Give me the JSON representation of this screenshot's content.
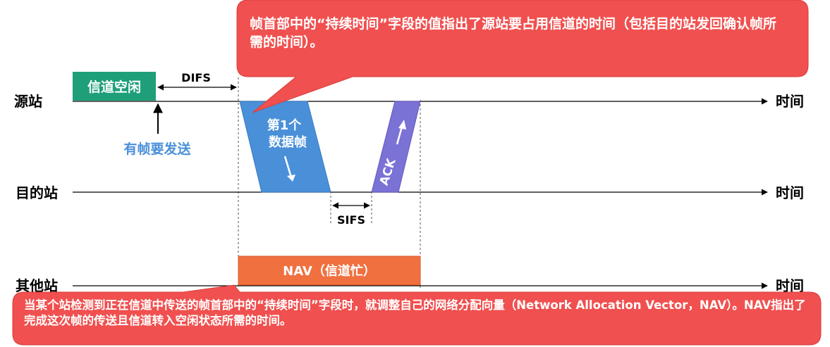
{
  "stations": {
    "source": "源站",
    "dest": "目的站",
    "other": "其他站"
  },
  "time_label": "时间",
  "channel_idle": "信道空闲",
  "difs": "DIFS",
  "sifs": "SIFS",
  "has_frame": "有帧要发送",
  "data_frame": [
    "第1个",
    "数据帧"
  ],
  "ack": "ACK",
  "nav_bar": "NAV（信道忙）",
  "top_callout": "帧首部中的“持续时间”字段的值指出了源站要占用信道的时间（包括目的站发回确认帧所需的时间）。",
  "bottom_callout": "当某个站检测到正在信道中传送的帧首部中的“持续时间”字段时，就调整自己的网络分配向量（Network Allocation Vector，NAV）。NAV指出了完成这次帧的传送且信道转入空闲状态所需的时间。",
  "colors": {
    "idle_box": "#1e9f7a",
    "data_frame": "#4a90d9",
    "ack": "#7b72d6",
    "nav": "#f07040",
    "callout": "#f0504f",
    "has_frame_text": "#4a90d9"
  }
}
